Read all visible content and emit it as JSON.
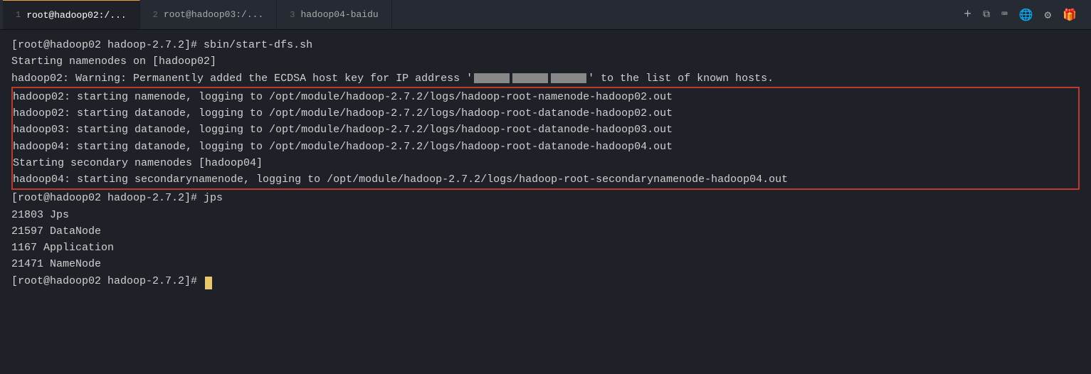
{
  "tabs": [
    {
      "id": 1,
      "label": "root@hadoop02:/...",
      "active": true
    },
    {
      "id": 2,
      "label": "root@hadoop03:/...",
      "active": false
    },
    {
      "id": 3,
      "label": "hadoop04-baidu",
      "active": false
    }
  ],
  "tab_actions": {
    "new_tab": "+",
    "restore": "⧉",
    "keyboard": "⌨",
    "globe": "🌐",
    "settings": "⚙",
    "gift": "🎁"
  },
  "terminal": {
    "lines": [
      {
        "type": "prompt",
        "text": "[root@hadoop02 hadoop-2.7.2]# sbin/start-dfs.sh"
      },
      {
        "type": "output",
        "text": "Starting namenodes on [hadoop02]"
      },
      {
        "type": "output",
        "text": "hadoop02: Warning: Permanently added the ECDSA host key for IP address '",
        "has_ip": true,
        "after_ip": "' to the list of known hosts."
      },
      {
        "type": "boxed_start"
      },
      {
        "type": "boxed",
        "text": "hadoop02: starting namenode, logging to /opt/module/hadoop-2.7.2/logs/hadoop-root-namenode-hadoop02.out"
      },
      {
        "type": "boxed",
        "text": "hadoop02: starting datanode, logging to /opt/module/hadoop-2.7.2/logs/hadoop-root-datanode-hadoop02.out"
      },
      {
        "type": "boxed",
        "text": "hadoop03: starting datanode, logging to /opt/module/hadoop-2.7.2/logs/hadoop-root-datanode-hadoop03.out"
      },
      {
        "type": "boxed",
        "text": "hadoop04: starting datanode, logging to /opt/module/hadoop-2.7.2/logs/hadoop-root-datanode-hadoop04.out"
      },
      {
        "type": "boxed",
        "text": "Starting secondary namenodes [hadoop04]"
      },
      {
        "type": "boxed",
        "text": "hadoop04: starting secondarynamenode, logging to /opt/module/hadoop-2.7.2/logs/hadoop-root-secondarynamenode-hadoop04.out"
      },
      {
        "type": "boxed_end"
      },
      {
        "type": "prompt",
        "text": "[root@hadoop02 hadoop-2.7.2]# jps"
      },
      {
        "type": "output",
        "text": "21803 Jps"
      },
      {
        "type": "output",
        "text": "21597 DataNode"
      },
      {
        "type": "output",
        "text": "1167 Application"
      },
      {
        "type": "output",
        "text": "21471 NameNode"
      },
      {
        "type": "prompt_cursor",
        "text": "[root@hadoop02 hadoop-2.7.2]# "
      }
    ]
  },
  "colors": {
    "active_tab_border": "#e8a040",
    "box_border": "#c0392b",
    "cursor_color": "#e8c86a",
    "text_main": "#d0d0d0",
    "bg": "#1e2228"
  }
}
